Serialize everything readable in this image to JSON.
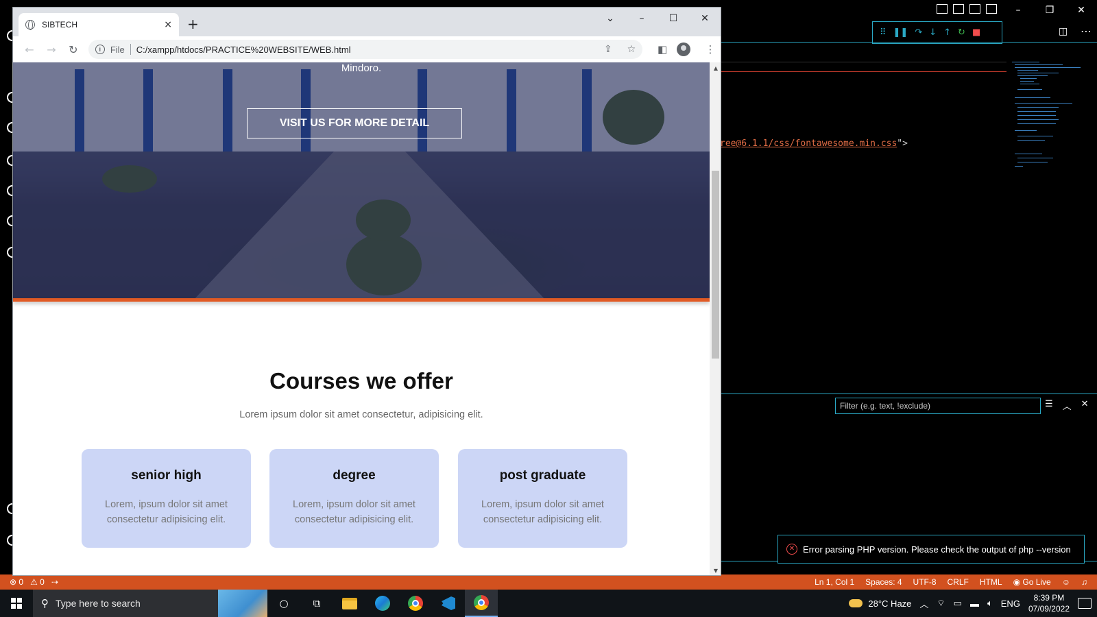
{
  "browser": {
    "tab_title": "SIBTECH",
    "tab_close": "×",
    "new_tab": "+",
    "window_buttons": {
      "tab_search": "⌄",
      "minimize": "–",
      "maximize": "☐",
      "close": "✕"
    },
    "nav": {
      "back": "←",
      "forward": "→",
      "reload": "↻"
    },
    "address": {
      "scheme_label": "File",
      "url": "C:/xampp/htdocs/PRACTICE%20WEBSITE/WEB.html"
    }
  },
  "page": {
    "hero": {
      "caption_tail": "Mindoro.",
      "visit_button": "VISIT US FOR MORE DETAIL"
    },
    "courses": {
      "title": "Courses we offer",
      "subtitle": "Lorem ipsum dolor sit amet consectetur, adipisicing elit.",
      "cards": [
        {
          "title": "senior high",
          "text": "Lorem, ipsum dolor sit amet consectetur adipisicing elit."
        },
        {
          "title": "degree",
          "text": "Lorem, ipsum dolor sit amet consectetur adipisicing elit."
        },
        {
          "title": "post graduate",
          "text": "Lorem, ipsum dolor sit amet consectetur adipisicing elit."
        }
      ]
    }
  },
  "vscode": {
    "code_snippet_red": "ree@6.1.1/css/fontawesome.min.css",
    "code_snippet_tail": "\">",
    "filter_placeholder": "Filter (e.g. text, !exclude)",
    "notification": "Error parsing PHP version. Please check the output of php --version",
    "statusbar": {
      "errors": "⊗ 0",
      "warnings": "⚠ 0",
      "position": "Ln 1, Col 1",
      "spaces": "Spaces: 4",
      "encoding": "UTF-8",
      "eol": "CRLF",
      "language": "HTML",
      "golive": "Go Live"
    },
    "colors": {
      "accent": "#2aa8c4",
      "statusbar": "#d2511f",
      "error": "#f14c4c"
    }
  },
  "taskbar": {
    "search_placeholder": "Type here to search",
    "weather": "28°C  Haze",
    "language": "ENG",
    "time": "8:39 PM",
    "date": "07/09/2022"
  },
  "colors": {
    "hero_stripe": "#e15a24",
    "card_bg": "#ccd6f6"
  }
}
